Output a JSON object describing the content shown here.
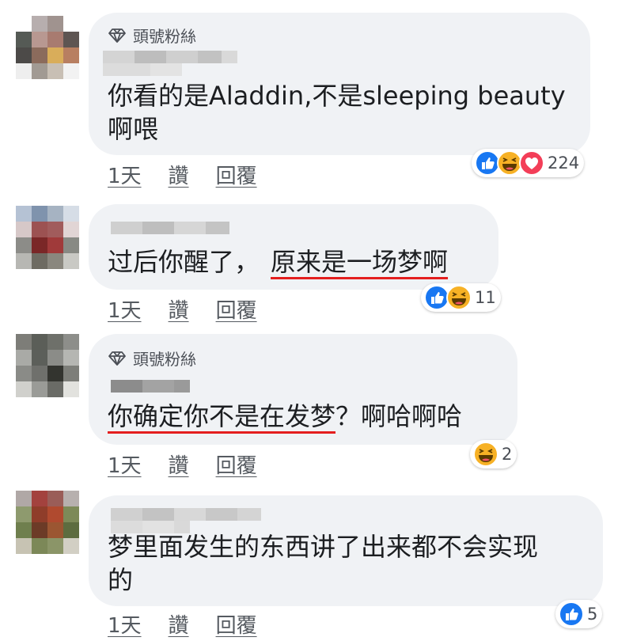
{
  "comments": [
    {
      "badge": "頭號粉絲",
      "text_lines": [
        "你看的是Aladdin,不是sleeping beauty",
        "啊喂"
      ],
      "text_underlined": "",
      "text_after": "",
      "time": "1天",
      "like_label": "讚",
      "reply_label": "回覆",
      "reactions": [
        "like-icon",
        "haha-icon",
        "love-icon"
      ],
      "reaction_count": "224"
    },
    {
      "badge": "",
      "text_before": "过后你醒了，",
      "text_underlined": "原来是一场梦啊",
      "text_after": "",
      "time": "1天",
      "like_label": "讚",
      "reply_label": "回覆",
      "reactions": [
        "like-icon",
        "haha-icon"
      ],
      "reaction_count": "11"
    },
    {
      "badge": "頭號粉絲",
      "text_before": "",
      "text_underlined": "你确定你不是在发梦",
      "text_after": "？啊哈啊哈",
      "time": "1天",
      "like_label": "讚",
      "reply_label": "回覆",
      "reactions": [
        "haha-icon"
      ],
      "reaction_count": "2"
    },
    {
      "badge": "",
      "text_lines": [
        "梦里面发生的东西讲了出来都不会实现",
        "的"
      ],
      "text_underlined": "",
      "text_after": "",
      "time": "1天",
      "like_label": "讚",
      "reply_label": "回覆",
      "reactions": [
        "like-icon"
      ],
      "reaction_count": "5"
    }
  ],
  "colors": {
    "bubble": "#f0f2f5",
    "like": "#1877f2",
    "love": "#f33e58",
    "haha": "#f7b125",
    "underline": "#e41e1e"
  }
}
